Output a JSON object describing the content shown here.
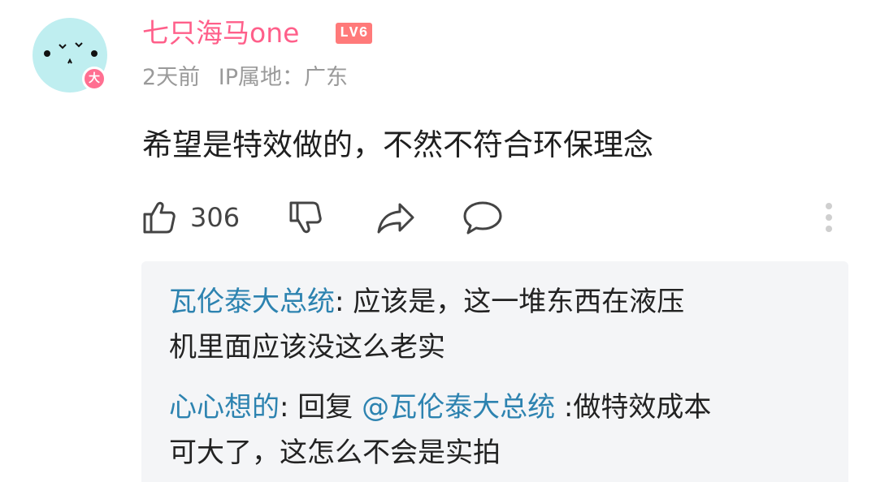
{
  "comment": {
    "user": {
      "name": "七只海马one",
      "level": "LV6",
      "avatar_badge": "大",
      "avatar_color": "#bfeef0",
      "name_color": "#ff5f8a"
    },
    "time": "2天前",
    "ip_location": "IP属地：广东",
    "text": "希望是特效做的，不然不符合环保理念",
    "likes": "306"
  },
  "actions": {
    "like_icon": "thumbs-up-icon",
    "dislike_icon": "thumbs-down-icon",
    "share_icon": "share-arrow-icon",
    "reply_icon": "speech-bubble-icon",
    "more_icon": "more-vertical-icon"
  },
  "replies": [
    {
      "author": "瓦伦泰大总统",
      "separator": ": ",
      "line1": "应该是，这一堆东西在液压",
      "line2": "机里面应该没这么老实"
    },
    {
      "author": "心心想的",
      "separator": ": ",
      "reply_prefix": "回复 ",
      "mention": "@瓦伦泰大总统",
      "line1": " :做特效成本",
      "line2": "可大了，这怎么不会是实拍"
    }
  ],
  "colors": {
    "link": "#2d83b0",
    "reply_bg": "#f4f5f7",
    "meta": "#9a9a9a"
  }
}
